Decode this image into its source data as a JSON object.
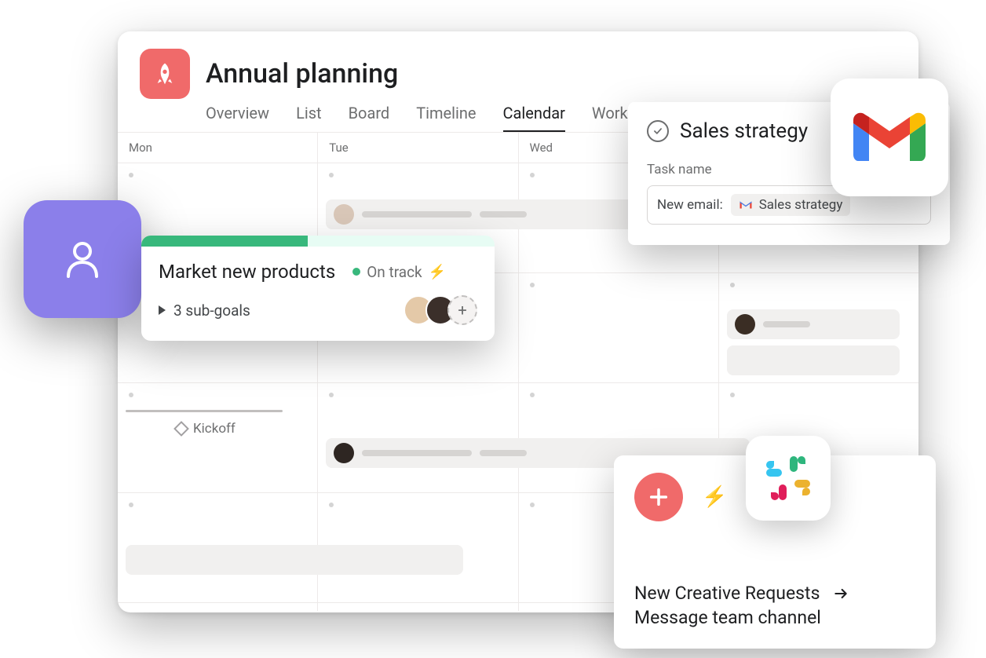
{
  "project": {
    "title": "Annual planning"
  },
  "tabs": {
    "overview": "Overview",
    "list": "List",
    "board": "Board",
    "timeline": "Timeline",
    "calendar": "Calendar",
    "workflow": "Workflow"
  },
  "days": {
    "mon": "Mon",
    "tue": "Tue",
    "wed": "Wed"
  },
  "milestone": {
    "kickoff": "Kickoff"
  },
  "goal": {
    "title": "Market new products",
    "status": "On track",
    "sub": "3 sub-goals"
  },
  "sales": {
    "title": "Sales strategy",
    "field_label": "Task name",
    "prefix": "New email:",
    "chip": "Sales strategy"
  },
  "slack": {
    "line1": "New Creative Requests",
    "line2": "Message team channel"
  }
}
